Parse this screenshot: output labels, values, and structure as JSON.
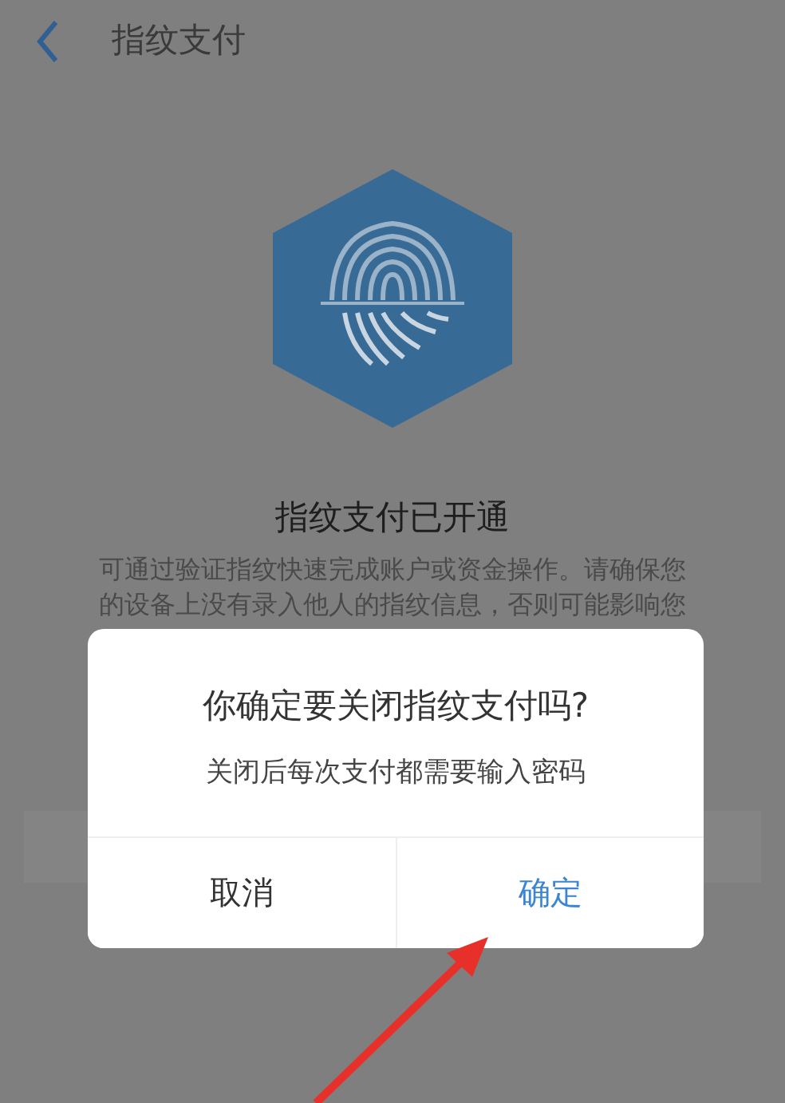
{
  "header": {
    "title": "指纹支付"
  },
  "status": {
    "title": "指纹支付已开通",
    "description": [
      "可通过验证指纹快速完成账户或资金操作。请确保您",
      "的设备上没有录入他人的指纹信息，否则可能影响您"
    ]
  },
  "dialog": {
    "title": "你确定要关闭指纹支付吗?",
    "message": "关闭后每次支付都需要输入密码",
    "buttons": [
      {
        "label": "取消",
        "kind": "cancel"
      },
      {
        "label": "确定",
        "kind": "confirm"
      }
    ]
  }
}
